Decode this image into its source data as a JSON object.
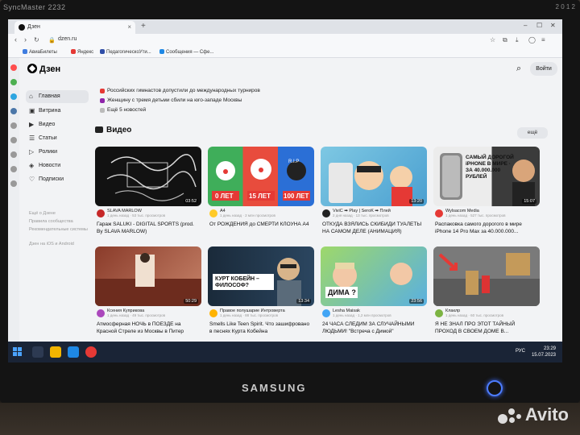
{
  "monitor": {
    "model": "SyncMaster 2232",
    "brand": "SAMSUNG",
    "corner_text": "2 0 1 2"
  },
  "watermark": "Avito",
  "browser": {
    "tab_title": "Дзен",
    "url": "dzen.ru",
    "bookmarks": [
      "АвиаБилеты",
      "Яндекс",
      "ПедагогическоУти...",
      "Сообщения — Сфе..."
    ]
  },
  "header": {
    "logo": "Дзен",
    "login_label": "Войти"
  },
  "nav": {
    "items": [
      "Главная",
      "Витрина",
      "Видео",
      "Статьи",
      "Ролики",
      "Новости",
      "Подписки"
    ],
    "small_links": [
      "Ещё о Дзене",
      "Правила сообщества",
      "Рекомендательные системы",
      "Дзен на iOS и Android"
    ]
  },
  "news": {
    "items": [
      "Российских гимнастов допустили до международных турниров",
      "Женщину с тремя детьми сбили на юго-западе Москвы",
      "Ещё 5 новостей"
    ]
  },
  "video_section": {
    "title": "Видео",
    "more_label": "ещё"
  },
  "videos": [
    {
      "author": "SLAVA MARLOW",
      "sub": "1 день назад · 53 тыс. просмотров",
      "title": "Гараж SALUKI - DIGITAL SPORTS (prod. By SLAVA MARLOW)",
      "duration": "03:52",
      "overlay": "DIGITAL SPORTS"
    },
    {
      "author": "A4",
      "sub": "1 день назад · 2 млн просмотров",
      "title": "От РОЖДЕНИЯ до СМЕРТИ КЛОУНА А4",
      "duration": "",
      "overlay": "0 ЛЕТ · 15 ЛЕТ · 100 ЛЕТ · КЛОУН А4"
    },
    {
      "author": "ViviC ➡ Play | SeroK ➡ Плей",
      "sub": "2 дня назад · 13 тыс. просмотров",
      "title": "ОТКУДА ВЗЯЛИСЬ СКИБИДИ ТУАЛЕТЫ НА САМОМ ДЕЛЕ (АНИМАЦИЯ)",
      "duration": "13:20",
      "overlay": ""
    },
    {
      "author": "Wylsacom Media",
      "sub": "1 день назад · 527 тыс. просмотров",
      "title": "Распаковка самого дорогого в мире iPhone 14 Pro Max за 40.000.000...",
      "duration": "15:07",
      "overlay": "САМЫЙ ДОРОГОЙ iPHONE В МИРЕ · ЗА 40.000.000 РУБЛЕЙ"
    },
    {
      "author": "Ксения Куприкова",
      "sub": "1 день назад · 49 тыс. просмотров",
      "title": "Атмосферная НОЧЬ в ПОЕЗДЕ на Красной Стреле из Москвы в Питер",
      "duration": "50:29",
      "overlay": ""
    },
    {
      "author": "Правое полушарие Интроверта",
      "sub": "1 день назад · 88 тыс. просмотров",
      "title": "Smells Like Teen Spirit. Что зашифровано в песнях Курта Кобейна",
      "duration": "13:34",
      "overlay": "КУРТ КОБЕЙН – ФИЛОСОФ?"
    },
    {
      "author": "Lesha Maisak",
      "sub": "1 день назад · 1,2 млн просмотров",
      "title": "24 ЧАСА СЛЕДИМ ЗА СЛУЧАЙНЫМИ ЛЮДЬМИ! \"Встреча с Димой\"",
      "duration": "23:56",
      "overlay": "ДИМА ?"
    },
    {
      "author": "Клаклр",
      "sub": "1 день назад · 60 тыс. просмотров",
      "title": "Я НЕ ЗНАЛ ПРО ЭТОТ ТАЙНЫЙ ПРОХОД В СВОЕМ ДОМЕ В...",
      "duration": "",
      "overlay": ""
    }
  ],
  "taskbar": {
    "lang": "РУС",
    "time": "23:29",
    "date": "15.07.2023"
  },
  "colors": {
    "dzen_bg": "#f2f3f5",
    "taskbar": "#1a2436",
    "power_led": "#3d6dff"
  }
}
